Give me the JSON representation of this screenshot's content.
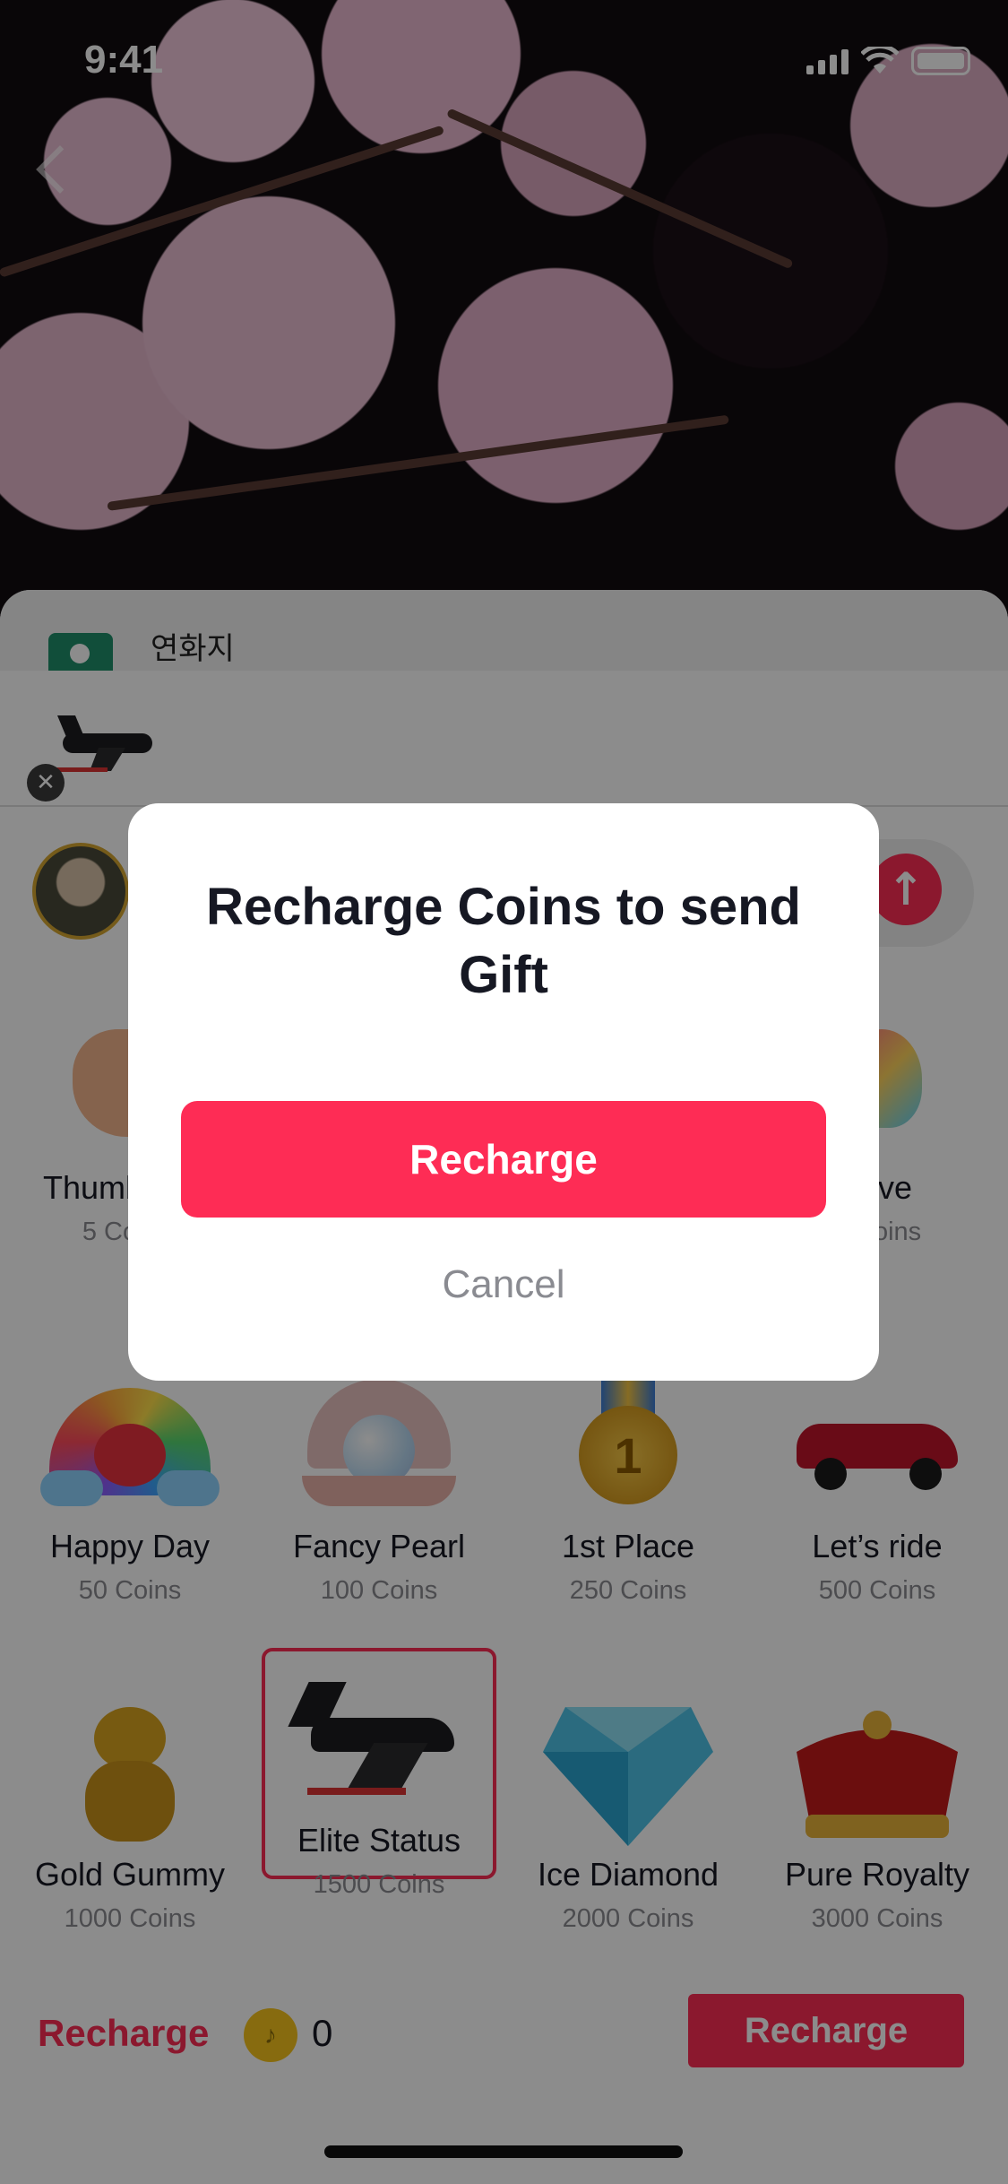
{
  "status_bar": {
    "time": "9:41"
  },
  "sheet": {
    "header_name": "연화지",
    "gifts": [
      {
        "name": "Thumbs Up",
        "price": "5 Coins"
      },
      {
        "name": "Love",
        "price": "5 Coins"
      },
      {
        "name": "Happy Day",
        "price": "50 Coins"
      },
      {
        "name": "Fancy Pearl",
        "price": "100 Coins"
      },
      {
        "name": "1st Place",
        "price": "250 Coins"
      },
      {
        "name": "Let’s ride",
        "price": "500 Coins"
      },
      {
        "name": "Gold Gummy",
        "price": "1000 Coins"
      },
      {
        "name": "Elite Status",
        "price": "1500 Coins"
      },
      {
        "name": "Ice Diamond",
        "price": "2000 Coins"
      },
      {
        "name": "Pure Royalty",
        "price": "3000 Coins"
      }
    ],
    "bottom": {
      "recharge_link": "Recharge",
      "coin_balance": "0",
      "recharge_button": "Recharge"
    }
  },
  "dialog": {
    "title": "Recharge Coins to send Gift",
    "recharge_label": "Recharge",
    "cancel_label": "Cancel"
  },
  "colors": {
    "accent": "#fe2c55",
    "coin": "#f6c41c"
  }
}
